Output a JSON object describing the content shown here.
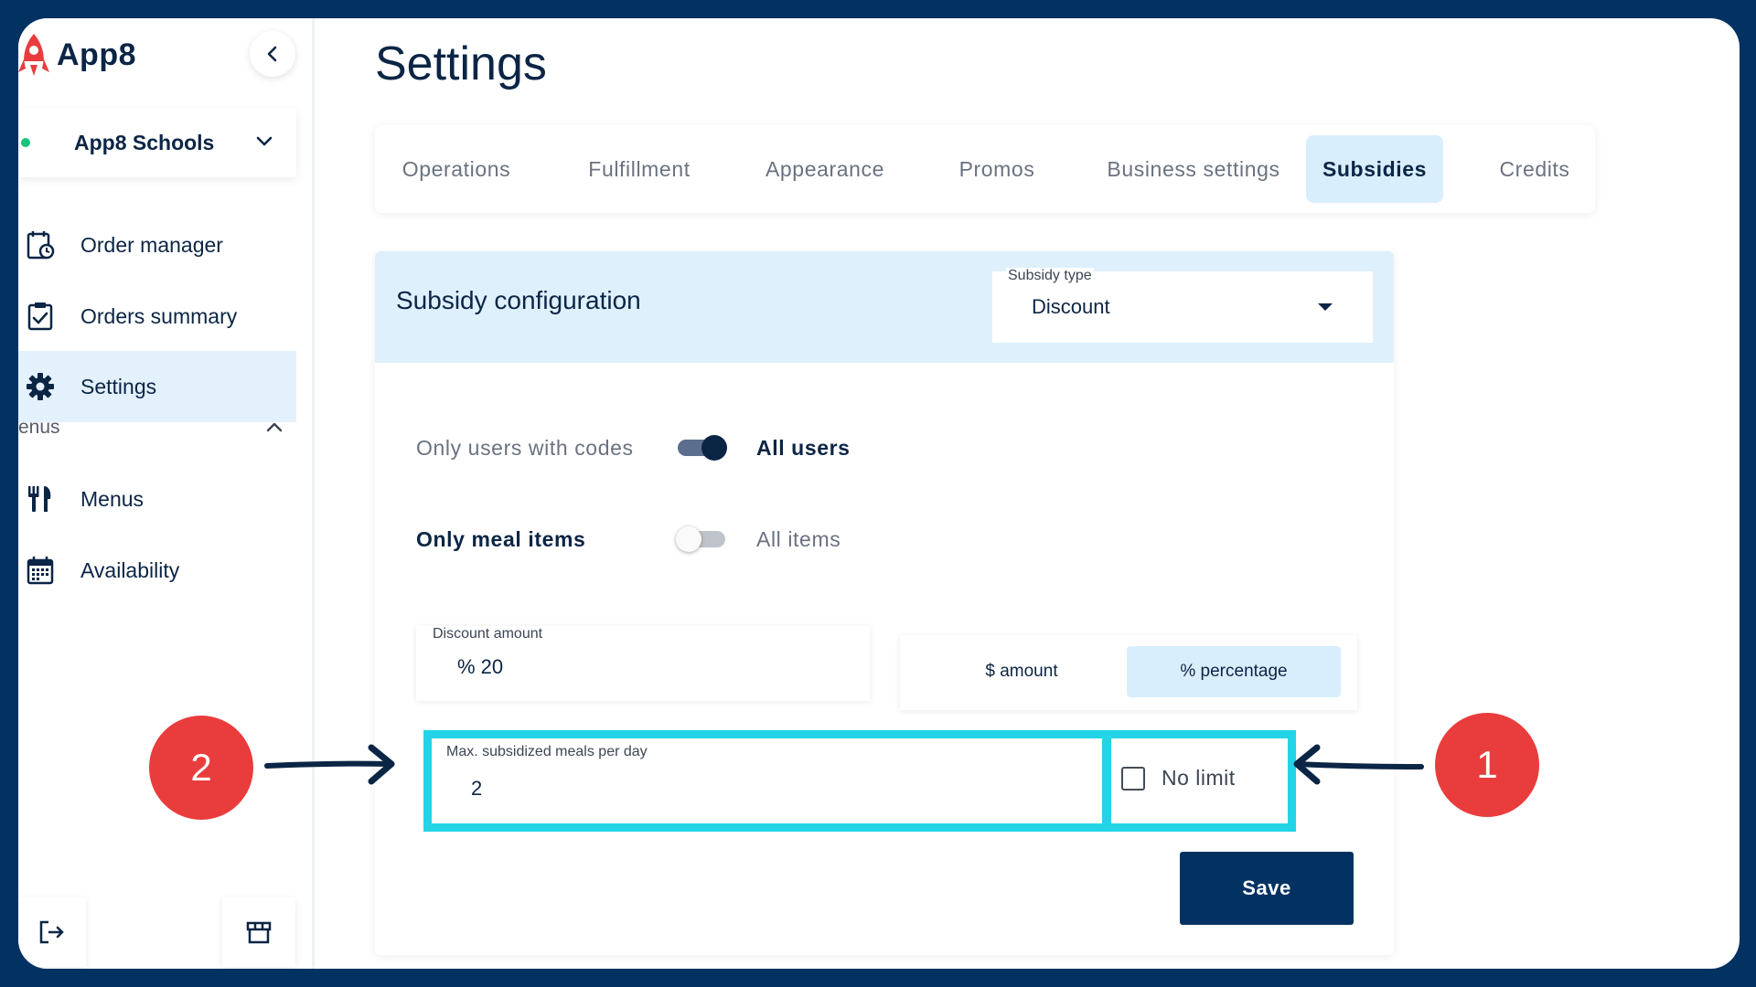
{
  "app": {
    "name": "App8"
  },
  "sidebar": {
    "org": "App8 Schools",
    "items": [
      {
        "label": "Order manager",
        "icon": "order-manager-icon"
      },
      {
        "label": "Orders summary",
        "icon": "clipboard-check-icon"
      },
      {
        "label": "Settings",
        "icon": "gear-icon",
        "active": true
      },
      {
        "label": "Menus",
        "icon": "fork-knife-icon"
      },
      {
        "label": "Availability",
        "icon": "calendar-icon"
      }
    ],
    "section_label": "enus"
  },
  "page": {
    "title": "Settings"
  },
  "tabs": [
    {
      "label": "Operations"
    },
    {
      "label": "Fulfillment"
    },
    {
      "label": "Appearance"
    },
    {
      "label": "Promos"
    },
    {
      "label": "Business settings"
    },
    {
      "label": "Subsidies",
      "active": true
    },
    {
      "label": "Credits"
    }
  ],
  "subsidy": {
    "title": "Subsidy configuration",
    "type_label": "Subsidy type",
    "type_value": "Discount",
    "users_toggle": {
      "left": "Only users with codes",
      "right": "All users",
      "state": "on"
    },
    "items_toggle": {
      "left": "Only meal items",
      "right": "All items",
      "state": "off"
    },
    "discount_label": "Discount amount",
    "discount_value": "% 20",
    "mode_options": [
      "$ amount",
      "% percentage"
    ],
    "mode_selected": "% percentage",
    "max_meals_label": "Max. subsidized meals per day",
    "max_meals_value": "2",
    "no_limit_label": "No limit",
    "no_limit_checked": false,
    "save_label": "Save"
  },
  "annotations": {
    "callout_1": "1",
    "callout_2": "2"
  },
  "colors": {
    "frame": "#023262",
    "primary": "#023262",
    "active_bg": "#d9eefc",
    "highlight": "#22d4e6",
    "callout": "#e93d3d"
  }
}
